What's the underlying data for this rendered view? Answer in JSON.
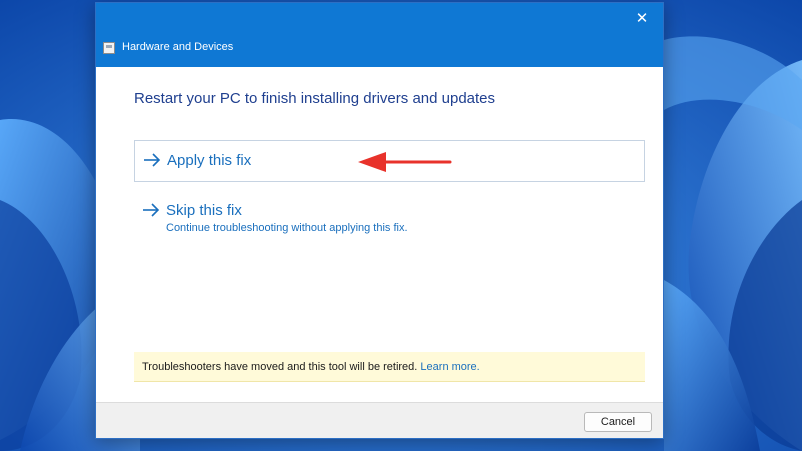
{
  "window": {
    "title": "Hardware and Devices",
    "close_glyph": "✕"
  },
  "content": {
    "heading": "Restart your PC to finish installing drivers and updates",
    "options": [
      {
        "label": "Apply this fix",
        "description": "",
        "icon": "arrow-right-icon",
        "selected": true
      },
      {
        "label": "Skip this fix",
        "description": "Continue troubleshooting without applying this fix.",
        "icon": "arrow-right-icon",
        "selected": false
      }
    ],
    "annotation": {
      "icon": "red-pointer-arrow-icon",
      "color": "#e8322b"
    }
  },
  "notice": {
    "text": "Troubleshooters have moved and this tool will be retired.",
    "link": "Learn more."
  },
  "footer": {
    "cancel_label": "Cancel"
  },
  "colors": {
    "titlebar": "#0f78d4",
    "accent_text": "#1a6fbd",
    "heading_text": "#1f3f8f",
    "notice_bg": "#fffad9",
    "desktop_bg": "#1a63c9"
  }
}
